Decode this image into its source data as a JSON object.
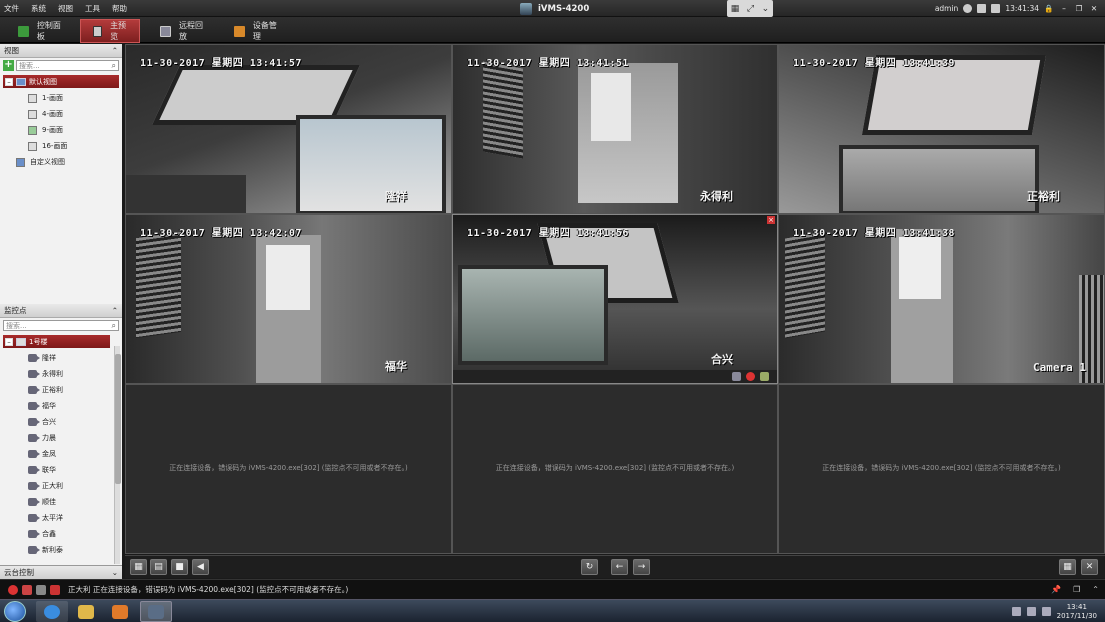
{
  "menu": [
    "文件",
    "系统",
    "视图",
    "工具",
    "帮助"
  ],
  "app_title": "iVMS-4200",
  "user": "admin",
  "clock_top": "13:41:34",
  "tabs": [
    {
      "label": "控制面板",
      "icon": "control-panel-icon",
      "active": false
    },
    {
      "label": "主预览",
      "icon": "main-preview-icon",
      "active": true
    },
    {
      "label": "远程回放",
      "icon": "remote-playback-icon",
      "active": false
    },
    {
      "label": "设备管理",
      "icon": "device-management-icon",
      "active": false
    }
  ],
  "view_panel": {
    "header": "视图",
    "search_placeholder": "搜索...",
    "root": "默认视图",
    "items": [
      "1-画面",
      "4-画面",
      "9-画面",
      "16-画面"
    ],
    "custom": "自定义视图"
  },
  "camera_panel": {
    "header": "监控点",
    "search_placeholder": "搜索...",
    "root": "1号楼",
    "items": [
      "隆祥",
      "永得利",
      "正裕利",
      "福华",
      "合兴",
      "力晨",
      "金凤",
      "联华",
      "正大利",
      "顺佳",
      "太平洋",
      "合鑫",
      "新利泰"
    ]
  },
  "ptz_header": "云台控制",
  "cells": [
    {
      "timestamp": "11-30-2017 星期四 13:41:57",
      "name": "隆祥"
    },
    {
      "timestamp": "11-30-2017 星期四 13:41:51",
      "name": "永得利"
    },
    {
      "timestamp": "11-30-2017 星期四 13:41:39",
      "name": "正裕利"
    },
    {
      "timestamp": "11-30-2017 星期四 13:42:07",
      "name": "福华"
    },
    {
      "timestamp": "11-30-2017 星期四 13:41:56",
      "name": "合兴"
    },
    {
      "timestamp": "11-30-2017 星期四 13:41:38",
      "name": "Camera 1"
    }
  ],
  "connecting_msg": "正在连接设备，错误码为 iVMS-4200.exe[302] (监控点不可用或者不存在。)",
  "status_msg": "正大利 正在连接设备，错误码为 iVMS-4200.exe[302] (监控点不可用或者不存在。)",
  "taskbar_time": "13:41",
  "taskbar_date": "2017/11/30"
}
